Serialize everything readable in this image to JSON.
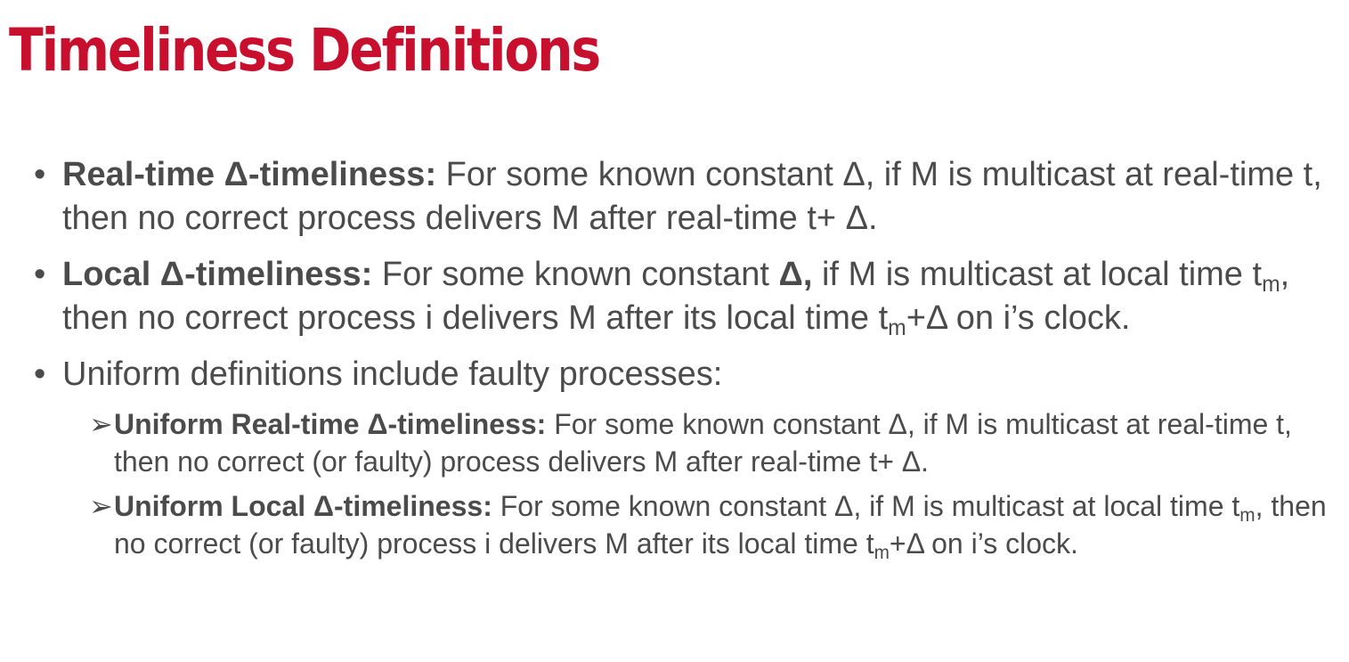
{
  "title": "Timeliness Definitions",
  "bullets": [
    {
      "term": "Real-time Δ-timeliness:",
      "text": " For some known constant Δ, if M is multicast at real-time t, then no correct process delivers M after real-time t+ Δ."
    },
    {
      "term": "Local Δ-timeliness:",
      "text_a": " For some known constant ",
      "delta_bold": "Δ,",
      "text_b": " if M is multicast at local time t",
      "sub1": "m",
      "text_c": ", then no correct process i delivers M after its local time t",
      "sub2": "m",
      "text_d": "+Δ on i’s clock."
    },
    {
      "text": "Uniform definitions include faulty processes:"
    }
  ],
  "sub_bullets": [
    {
      "marker": "➢",
      "term": "Uniform Real-time Δ-timeliness:",
      "text": " For some known constant Δ, if M is multicast at real-time t, then no correct (or faulty) process delivers M after real-time t+ Δ."
    },
    {
      "marker": "➢",
      "term": "Uniform Local Δ-timeliness:",
      "text_a": " For some known constant Δ, if M is multicast at local time t",
      "sub1": "m",
      "text_b": ", then no correct (or faulty) process i delivers M after its local time t",
      "sub2": "m",
      "text_c": "+Δ on i’s clock."
    }
  ]
}
